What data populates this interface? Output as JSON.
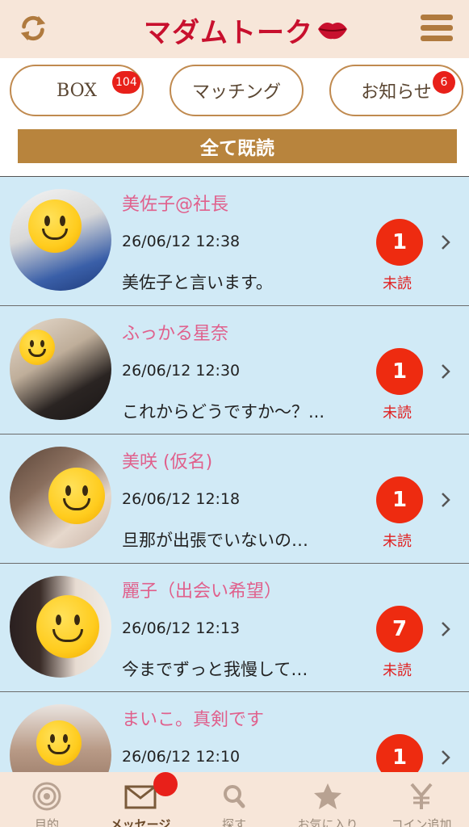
{
  "header": {
    "logo_text": "マダムトーク",
    "icons": [
      "refresh-icon",
      "lips-icon",
      "menu-icon"
    ]
  },
  "tabs": [
    {
      "label": "BOX",
      "badge": "104"
    },
    {
      "label": "マッチング",
      "badge": ""
    },
    {
      "label": "お知らせ",
      "badge": "6"
    }
  ],
  "read_all_label": "全て既読",
  "messages": [
    {
      "name": "美佐子@社長",
      "time": "26/06/12 12:38",
      "preview": "美佐子と言います。",
      "count": "1",
      "status": "未読"
    },
    {
      "name": "ふっかる星奈",
      "time": "26/06/12 12:30",
      "preview": "これからどうですか～？...",
      "count": "1",
      "status": "未読"
    },
    {
      "name": "美咲 (仮名)",
      "time": "26/06/12 12:18",
      "preview": "旦那が出張でいないの…",
      "count": "1",
      "status": "未読"
    },
    {
      "name": "麗子（出会い希望）",
      "time": "26/06/12 12:13",
      "preview": "今までずっと我慢して…",
      "count": "7",
      "status": "未読"
    },
    {
      "name": "まいこ。真剣です",
      "time": "26/06/12 12:10",
      "preview": "",
      "count": "1",
      "status": ""
    }
  ],
  "bottom_nav": [
    {
      "label": "目的",
      "icon": "target-icon"
    },
    {
      "label": "メッセージ",
      "icon": "mail-icon"
    },
    {
      "label": "探す",
      "icon": "search-icon"
    },
    {
      "label": "お気に入り",
      "icon": "star-icon"
    },
    {
      "label": "コイン追加",
      "icon": "yen-icon"
    }
  ],
  "colors": {
    "accent": "#b8843d",
    "header_bg": "#f7e6d9",
    "row_bg": "#d1eaf6",
    "name": "#e0608c",
    "badge": "#e8201a"
  }
}
